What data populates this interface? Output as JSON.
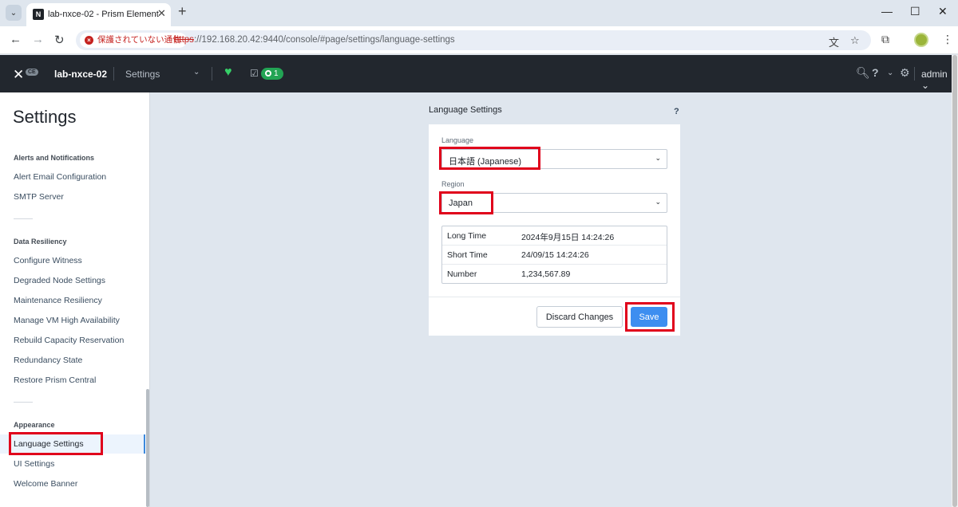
{
  "browser": {
    "tab_title": "lab-nxce-02 - Prism Element",
    "favicon_letter": "N",
    "security_label": "保護されていない通信",
    "url_scheme": "https",
    "url_rest": "://192.168.20.42:9440/console/#page/settings/language-settings",
    "icons": {
      "tab_dropdown": "chevron-down-icon",
      "close_tab": "close-icon",
      "new_tab": "plus-icon",
      "back": "back-arrow-icon",
      "forward": "forward-arrow-icon",
      "reload": "reload-icon",
      "translate": "translate-icon",
      "bookmark": "star-icon",
      "extensions": "puzzle-icon",
      "menu": "kebab-menu-icon"
    }
  },
  "header": {
    "cluster_name": "lab-nxce-02",
    "nav_label": "Settings",
    "task_count": "1",
    "user": "admin",
    "health_color": "#36d068",
    "task_badge_color": "#22a454"
  },
  "sidebar": {
    "title": "Settings",
    "groups": [
      {
        "label": "Alerts and Notifications",
        "items": [
          "Alert Email Configuration",
          "SMTP Server"
        ]
      },
      {
        "label": "Data Resiliency",
        "items": [
          "Configure Witness",
          "Degraded Node Settings",
          "Maintenance Resiliency",
          "Manage VM High Availability",
          "Rebuild Capacity Reservation",
          "Redundancy State",
          "Restore Prism Central"
        ]
      },
      {
        "label": "Appearance",
        "items": [
          "Language Settings",
          "UI Settings",
          "Welcome Banner"
        ]
      }
    ],
    "active_item": "Language Settings"
  },
  "language_settings": {
    "title": "Language Settings",
    "help": "?",
    "language_label": "Language",
    "language_value": "日本語 (Japanese)",
    "region_label": "Region",
    "region_value": "Japan",
    "preview": [
      {
        "label": "Long Time",
        "value": "2024年9月15日 14:24:26"
      },
      {
        "label": "Short Time",
        "value": "24/09/15 14:24:26"
      },
      {
        "label": "Number",
        "value": "1,234,567.89"
      }
    ],
    "discard_label": "Discard Changes",
    "save_label": "Save",
    "save_color": "#3d8ef0"
  },
  "annotation_color": "#e0001b"
}
